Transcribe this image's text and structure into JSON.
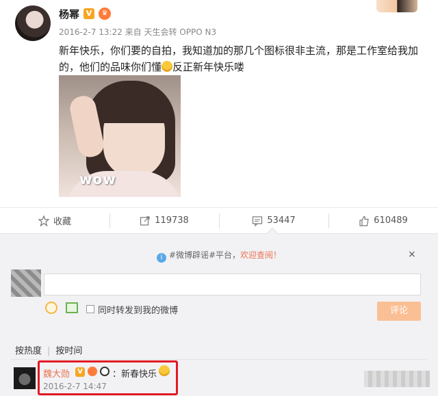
{
  "post": {
    "author": "杨幂",
    "verified_badge": "V",
    "meta": "2016-2-7 13:22 来自 天生会转 OPPO N3",
    "text_part1": "新年快乐，你们要的自拍，我知道加的那几个图标很非主流，那是工作室给我加的，他们的品味你们懂",
    "text_part2": "反正新年快乐喽",
    "photo_caption": "wow"
  },
  "actions": {
    "favorite_label": "收藏",
    "repost_count": "119738",
    "comment_count": "53447",
    "like_count": "610489"
  },
  "panel": {
    "notice_prefix": "#微博辟谣#平台，",
    "notice_link": "欢迎查阅！",
    "close_label": "×",
    "repost_checkbox_label": "同时转发到我的微博",
    "submit_label": "评论",
    "sort_hot": "按热度",
    "sort_sep": "|",
    "sort_time": "按时间"
  },
  "comment": {
    "author": "魏大勋",
    "verified_badge": "V",
    "text": "：新春快乐",
    "time": "2016-2-7 14:47"
  },
  "colors": {
    "accent": "#eb7350",
    "highlight_border": "#e21a23",
    "submit_bg": "#fbbf95"
  },
  "icons": [
    "star-icon",
    "repost-icon",
    "comment-icon",
    "like-icon",
    "info-icon",
    "close-icon",
    "emoji-icon",
    "image-icon"
  ]
}
